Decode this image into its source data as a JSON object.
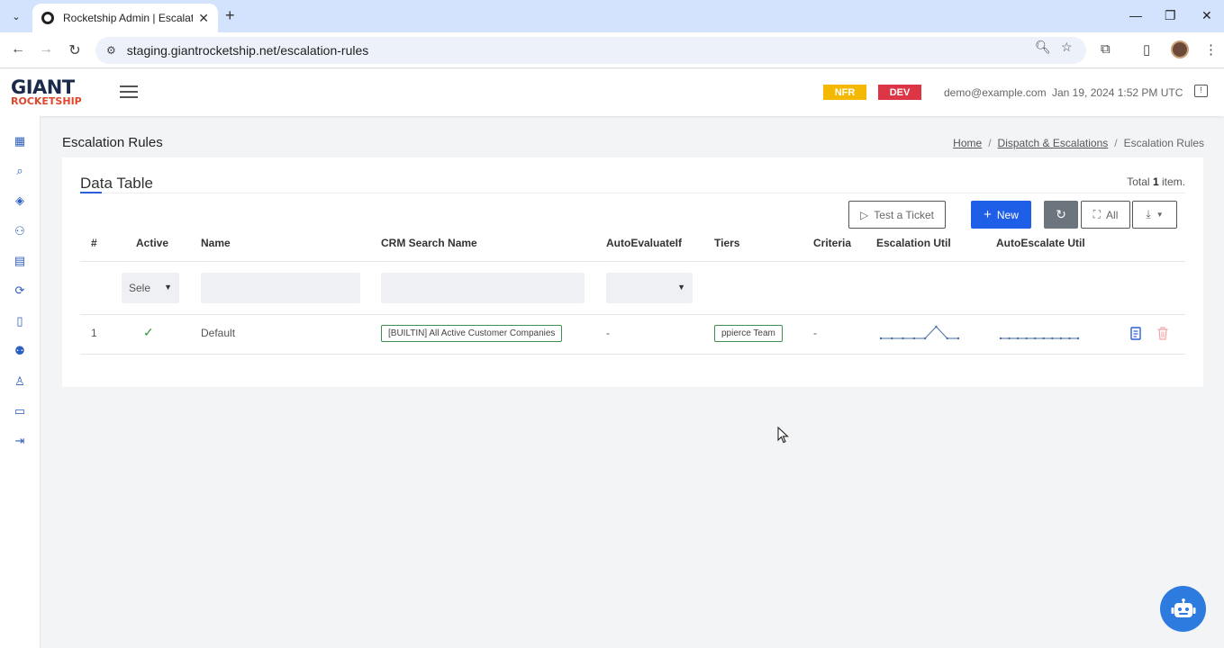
{
  "browser": {
    "tab_title": "Rocketship Admin | Escalation R",
    "url": "staging.giantrocketship.net/escalation-rules"
  },
  "header": {
    "logo_top": "GIANT",
    "logo_bottom": "ROCKETSHIP",
    "badge_nfr": "NFR",
    "badge_dev": "DEV",
    "user_email": "demo@example.com",
    "datetime": "Jan 19, 2024 1:52 PM UTC",
    "colors": {
      "nfr": "#f5b800",
      "dev": "#dc3545",
      "primary": "#1f5fe8"
    }
  },
  "sidebar": {
    "icons": [
      "dashboard-icon",
      "search-icon",
      "layers-icon",
      "network-icon",
      "calendar-icon",
      "sync-icon",
      "document-icon",
      "users-icon",
      "user-icon",
      "report-icon",
      "logout-icon"
    ]
  },
  "page": {
    "title": "Escalation Rules",
    "breadcrumb": {
      "home": "Home",
      "section": "Dispatch & Escalations",
      "current": "Escalation Rules",
      "separator": "/"
    }
  },
  "table_card": {
    "title": "Data Table",
    "total_prefix": "Total",
    "total_count": "1",
    "total_suffix": "item.",
    "buttons": {
      "test": "Test a Ticket",
      "new": "New",
      "all": "All"
    },
    "columns": [
      "#",
      "Active",
      "Name",
      "CRM Search Name",
      "AutoEvaluateIf",
      "Tiers",
      "Criteria",
      "Escalation Util",
      "AutoEscalate Util"
    ],
    "filters": {
      "active_select": "Sele"
    },
    "rows": [
      {
        "index": "1",
        "active": true,
        "name": "Default",
        "crm_search_name": "[BUILTIN] All Active Customer Companies",
        "auto_evaluate_if": "-",
        "tiers": "ppierce Team",
        "criteria": "-",
        "escalation_util": [
          0,
          0,
          0,
          0,
          0,
          1,
          0,
          0
        ],
        "autoescalate_util": [
          0,
          0,
          0,
          0,
          0,
          0,
          0,
          0,
          0,
          0
        ]
      }
    ]
  }
}
